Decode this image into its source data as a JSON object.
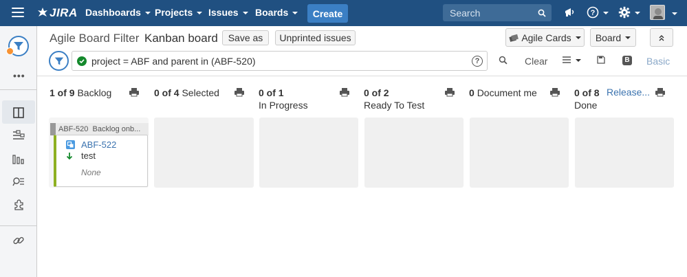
{
  "nav": {
    "logo": "JIRA",
    "items": [
      {
        "label": "Dashboards"
      },
      {
        "label": "Projects"
      },
      {
        "label": "Issues"
      },
      {
        "label": "Boards"
      }
    ],
    "create_label": "Create",
    "search_placeholder": "Search"
  },
  "board": {
    "filter_name": "Agile Board Filter",
    "board_name": "Kanban board",
    "save_as": "Save as",
    "unprinted": "Unprinted issues",
    "agile_cards": "Agile Cards",
    "board_menu": "Board"
  },
  "query": {
    "text": "project = ABF and parent in (ABF-520)",
    "clear": "Clear",
    "basic": "Basic",
    "basic_badge": "B"
  },
  "columns": [
    {
      "count": "1 of 9",
      "name": "Backlog"
    },
    {
      "count": "0 of 4",
      "name": "Selected"
    },
    {
      "count": "0 of 1",
      "name": "In Progress"
    },
    {
      "count": "0 of 2",
      "name": "Ready To Test"
    },
    {
      "count": "0",
      "name": "Document me"
    },
    {
      "count": "0 of 8",
      "name": "Done"
    }
  ],
  "release_link": "Release...",
  "swimlane": {
    "key": "ABF-520",
    "title": "Backlog onb..."
  },
  "card": {
    "key": "ABF-522",
    "summary": "test",
    "extra": "None"
  },
  "colors": {
    "nav": "#205081",
    "create": "#3b7fc4",
    "link": "#3b73af",
    "card_border": "#8eb021"
  }
}
